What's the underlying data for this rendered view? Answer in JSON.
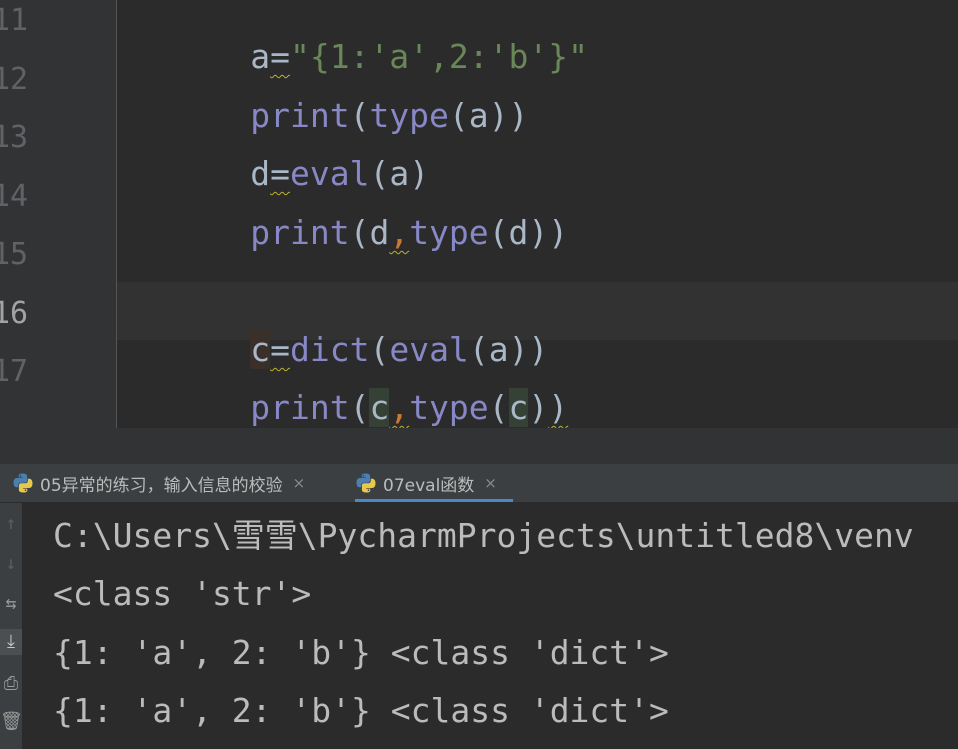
{
  "editor": {
    "line_numbers": [
      "11",
      "12",
      "13",
      "14",
      "15",
      "16",
      "17"
    ],
    "current_line": "16",
    "code": {
      "l11": {
        "var": "a",
        "op": "=",
        "str": "\"{1:'a',2:'b'}\""
      },
      "l12": {
        "fn": "print",
        "p1": "(",
        "fn2": "type",
        "p2": "(",
        "arg": "a",
        "p3": "))"
      },
      "l13": {
        "var": "d",
        "op": "=",
        "fn": "eval",
        "p1": "(",
        "arg": "a",
        "p2": ")"
      },
      "l14": {
        "fn": "print",
        "p1": "(",
        "arg": "d",
        "comma": ",",
        "fn2": "type",
        "p2": "(",
        "arg2": "d",
        "p3": "))"
      },
      "l16": {
        "var": "c",
        "op": "=",
        "fn": "dict",
        "p1": "(",
        "fn2": "eval",
        "p2": "(",
        "arg": "a",
        "p3": "))"
      },
      "l17": {
        "fn": "print",
        "p1": "(",
        "arg": "c",
        "comma": ",",
        "fn2": "type",
        "p2": "(",
        "arg2": "c",
        "p3": ")",
        "p4": ")"
      }
    }
  },
  "run_panel": {
    "tabs": [
      {
        "label": "05异常的练习，输入信息的校验",
        "icon": "python-icon",
        "active": false
      },
      {
        "label": "07eval函数",
        "icon": "python-icon",
        "active": true
      }
    ],
    "close_glyph": "×",
    "tools": [
      {
        "name": "scroll-up-icon",
        "glyph": "↑"
      },
      {
        "name": "scroll-down-icon",
        "glyph": "↓"
      },
      {
        "name": "soft-wrap-icon",
        "glyph": "⇆"
      },
      {
        "name": "scroll-to-end-icon",
        "glyph": "⤓"
      },
      {
        "name": "print-icon",
        "glyph": "⎙"
      },
      {
        "name": "trash-icon",
        "glyph": "🗑"
      }
    ],
    "output": [
      "C:\\Users\\雪雪\\PycharmProjects\\untitled8\\venv",
      "<class 'str'>",
      "{1: 'a', 2: 'b'} <class 'dict'>",
      "{1: 'a', 2: 'b'} <class 'dict'>"
    ]
  },
  "colors": {
    "background": "#2b2b2b",
    "string": "#6a8759",
    "builtin": "#8888c6",
    "punctuation": "#cc7832",
    "identifier": "#a9b7c6",
    "active_tab_underline": "#4a88c7"
  }
}
